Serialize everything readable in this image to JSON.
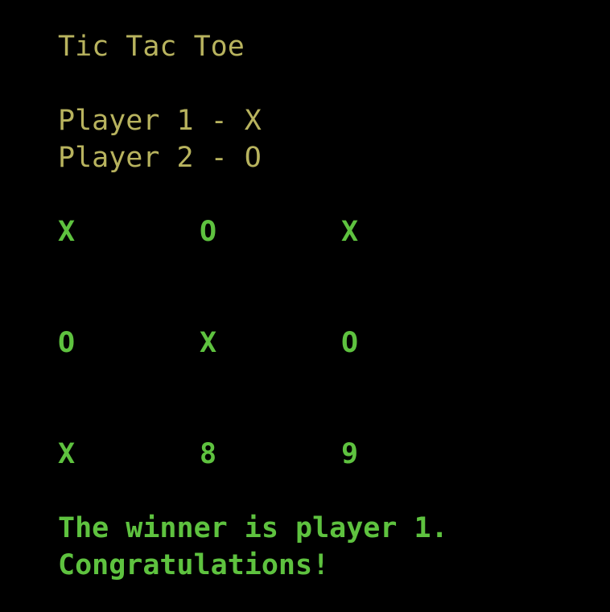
{
  "title": "Tic Tac Toe",
  "players": [
    "Player 1 - X",
    "Player 2 - O"
  ],
  "board": [
    [
      "X",
      "O",
      "X"
    ],
    [
      "O",
      "X",
      "O"
    ],
    [
      "X",
      "8",
      "9"
    ]
  ],
  "result": {
    "line1": "The winner is player 1.",
    "line2": "Congratulations!"
  },
  "colors": {
    "background": "#000000",
    "header_text": "#b8b35e",
    "board_text": "#5ec23f"
  }
}
